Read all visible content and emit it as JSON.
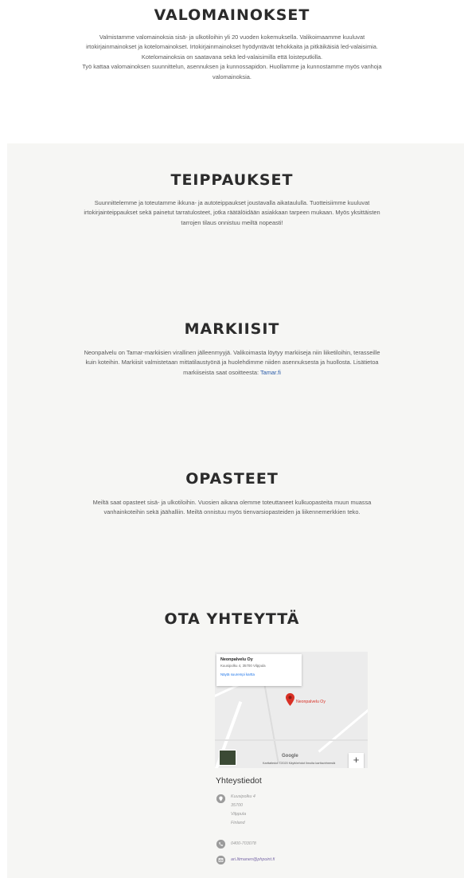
{
  "sections": {
    "valomainokset": {
      "title": "VALOMAINOKSET",
      "lines": [
        "Valmistamme valomainoksia sisä- ja ulkotiloihin yli 20 vuoden kokemuksella. Valikoimaamme kuuluvat",
        "irtokirjainmainokset ja kotelomainokset. Irtokirjainmainokset hyödyntävät tehokkaita ja pitkäikäisiä led-valaisimia.",
        "Kotelomainoksia on saatavana sekä led-valaisimilla että loisteputkilla.",
        "Työ kattaa valomainoksen suunnittelun, asennuksen ja kunnossapidon. Huollamme ja kunnostamme myös vanhoja",
        "valomainoksia."
      ]
    },
    "teippaukset": {
      "title": "TEIPPAUKSET",
      "lines": [
        "Suunnittelemme ja toteutamme ikkuna- ja autoteippaukset joustavalla aikataululla. Tuotteisiimme kuuluvat",
        "irtokirjainteippaukset sekä painetut tarratulosteet, jotka räätälöidään asiakkaan tarpeen mukaan. Myös yksittäisten",
        "tarrojen tilaus onnistuu meiltä nopeasti!"
      ]
    },
    "markiisit": {
      "title": "MARKIISIT",
      "lines": [
        "Neonpalvelu on Tamar-markiisien virallinen jälleenmyyjä. Valikoimasta löytyy markiiseja niin liiketiloihin, terasseille",
        "kuin koteihin. Markiisit valmistetaan mittatilaustyönä ja huolehdimme niiden asennuksesta ja huollosta. Lisätietoa"
      ],
      "last_line_prefix": "markiiseista saat osoitteesta: ",
      "link_text": "Tamar.fi"
    },
    "opasteet": {
      "title": "OPASTEET",
      "lines": [
        "Meiltä saat opasteet sisä- ja ulkotiloihin. Vuosien aikana olemme toteuttaneet kulkuopasteita muun muassa",
        "vanhainkoteihin sekä jäähalliin. Meiltä onnistuu myös tienvarsiopasteiden ja liikennemerkkien teko."
      ]
    },
    "contact": {
      "title": "OTA YHTEYTTÄ"
    }
  },
  "map": {
    "card_name": "Neonpalvelu Oy",
    "card_address": "Kuusipolku 4, 35700 Vilppula",
    "card_link": "Näytä suurempi kartta",
    "pin_label": "Neonpalvelu Oy",
    "zoom_in": "+",
    "zoom_out": "−",
    "google": "Google",
    "attribution": "Karttatiedot ©2020   Käyttöehdot   Ilmoita karttavirheestä"
  },
  "contact_info": {
    "title": "Yhteystiedot",
    "address_lines": [
      "Kuusipolku 4",
      "35700",
      "Vilppula",
      "Finland"
    ],
    "phone": "0400-703078",
    "email": "ari.litmanen@phpoint.fi"
  },
  "colors": {
    "heading": "#2b2b2b",
    "text": "#5a5a5a",
    "link": "#2b5ca8",
    "section_bg": "#f6f6f4",
    "pin": "#d93025"
  }
}
